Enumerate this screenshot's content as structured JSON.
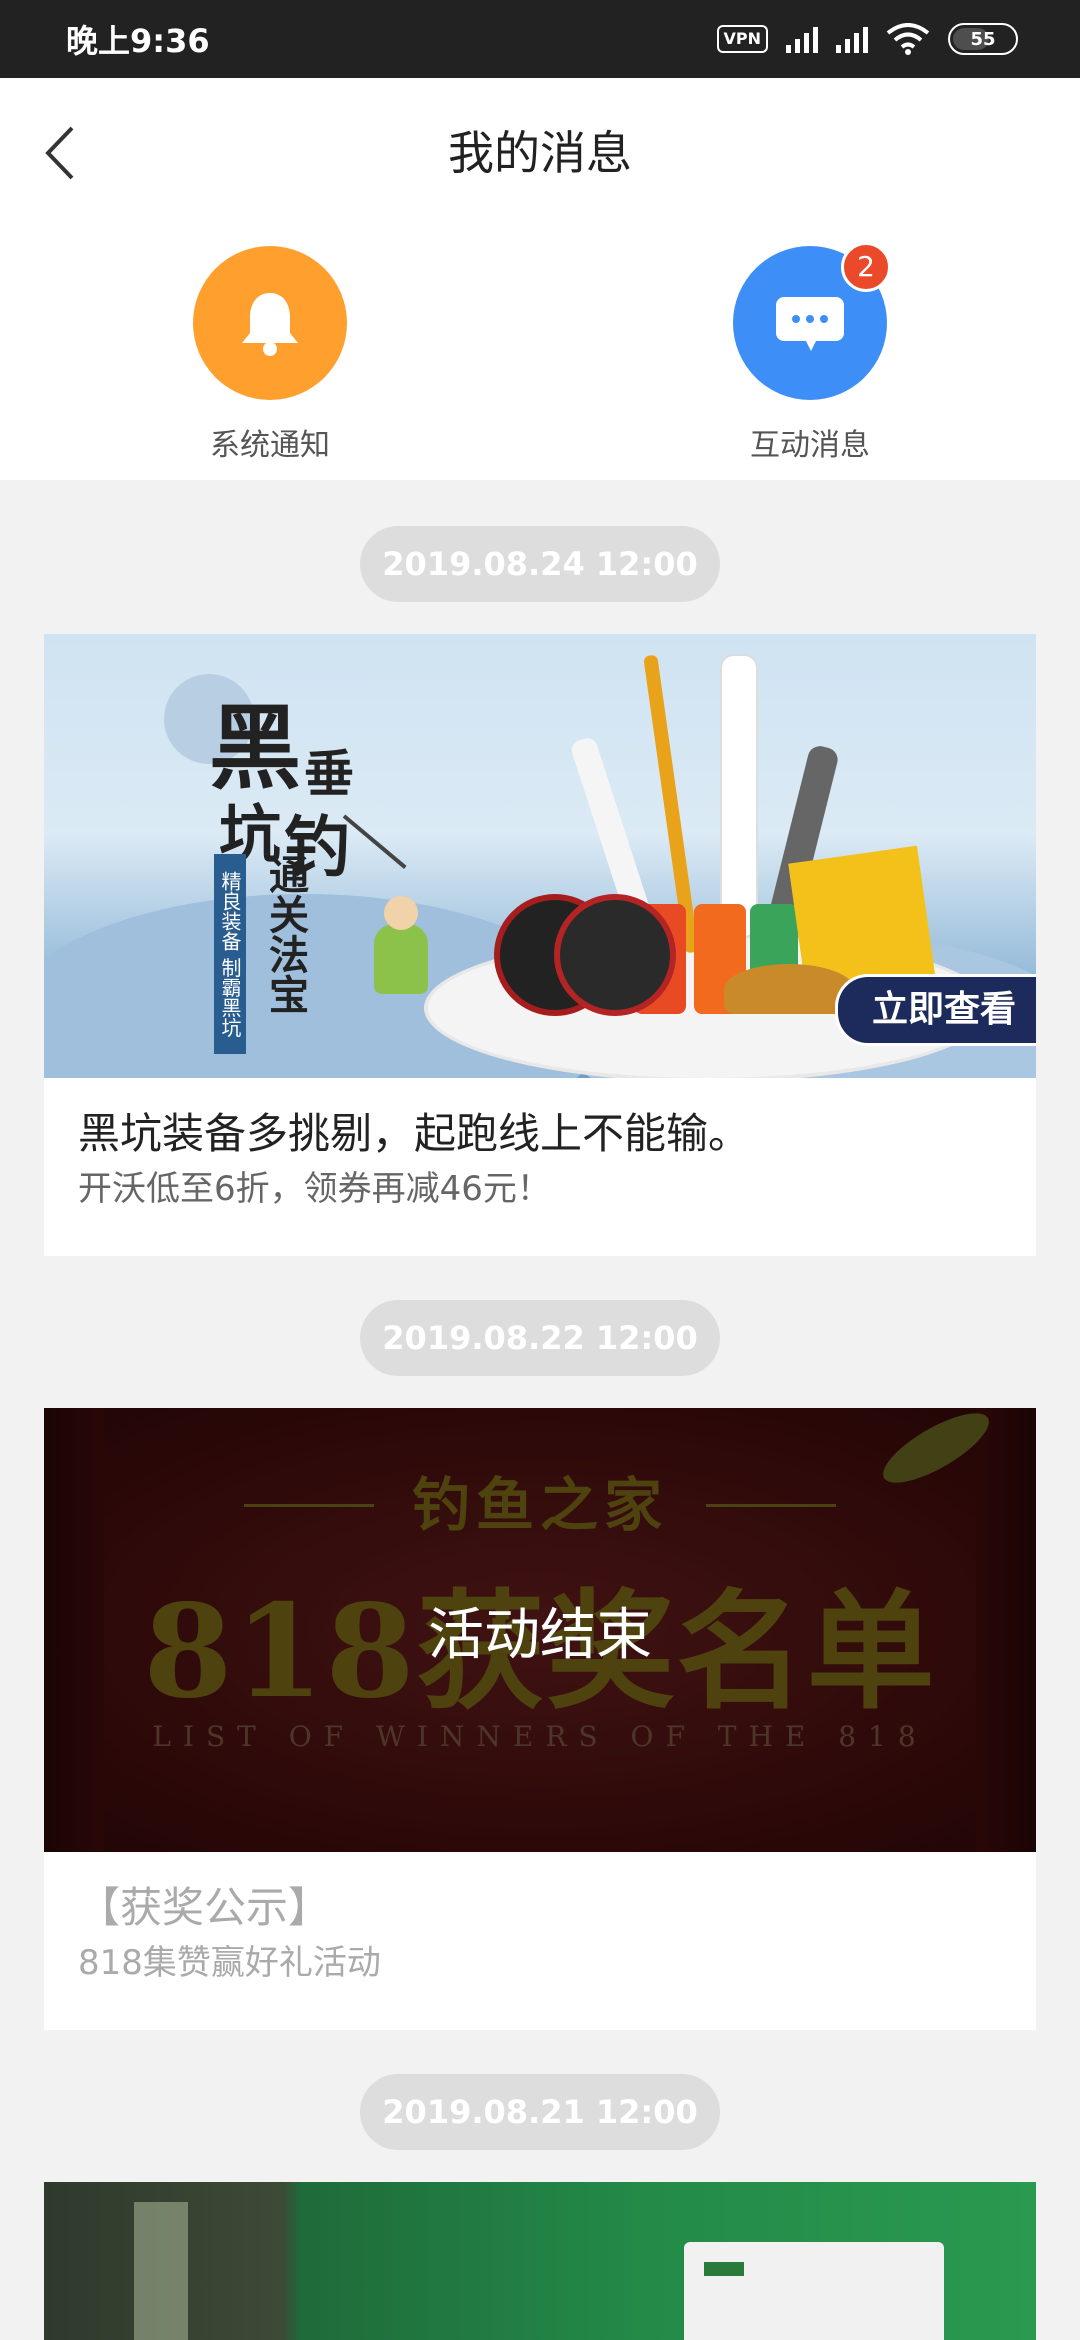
{
  "status_bar": {
    "time": "晚上9:36",
    "vpn": "VPN",
    "battery": "55"
  },
  "header": {
    "title": "我的消息"
  },
  "categories": [
    {
      "label": "系统通知",
      "icon": "bell-icon",
      "color": "#ffa02e"
    },
    {
      "label": "互动消息",
      "icon": "chat-bubble-icon",
      "color": "#3d8ef7",
      "badge": "2"
    }
  ],
  "feed": [
    {
      "date": "2019.08.24 12:00",
      "title": "黑坑装备多挑剔，起跑线上不能输。",
      "subtitle": "开沃低至6折，领券再减46元！",
      "banner": {
        "headline": "黑坑垂钓",
        "cta": "立即查看"
      }
    },
    {
      "date": "2019.08.22 12:00",
      "title": "【获奖公示】",
      "subtitle": "818集赞赢好礼活动",
      "banner": {
        "headline_top": "钓鱼之家",
        "headline_main": "818获奖名单",
        "headline_en": "LIST OF WINNERS OF THE 818",
        "overlay": "活动结束"
      }
    },
    {
      "date": "2019.08.21 12:00"
    }
  ]
}
